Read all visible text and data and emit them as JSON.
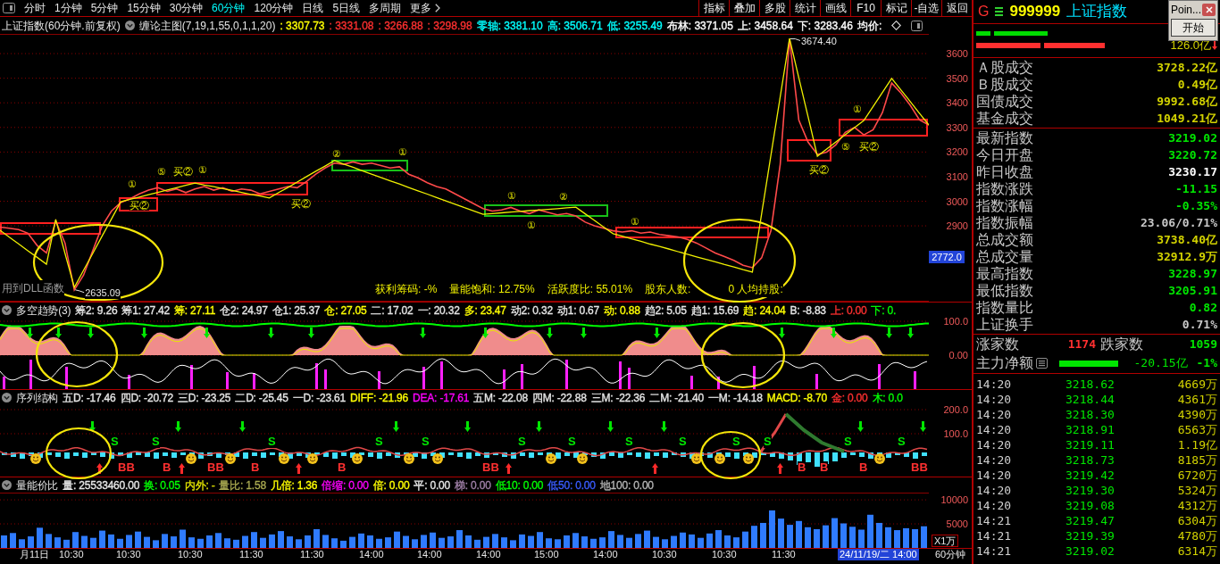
{
  "toolbar": {
    "periods": [
      {
        "label": "分时",
        "selected": false
      },
      {
        "label": "1分钟",
        "selected": false
      },
      {
        "label": "5分钟",
        "selected": false
      },
      {
        "label": "15分钟",
        "selected": false
      },
      {
        "label": "30分钟",
        "selected": false
      },
      {
        "label": "60分钟",
        "selected": true
      },
      {
        "label": "120分钟",
        "selected": false
      },
      {
        "label": "日线",
        "selected": false
      },
      {
        "label": "5日线",
        "selected": false
      },
      {
        "label": "多周期",
        "selected": false
      },
      {
        "label": "更多",
        "selected": false
      }
    ],
    "buttons": [
      "指标",
      "叠加",
      "多股",
      "统计",
      "画线",
      "F10",
      "标记",
      "-自选",
      "返回"
    ]
  },
  "main_chart": {
    "title": "上证指数(60分钟.前复权)",
    "indicator": "缠论主图(7,19,1,55,0,1,1,20)",
    "readouts": [
      {
        "text": ": 3307.73",
        "color": "#ffff00"
      },
      {
        "text": ": 3331.08",
        "color": "#ff3030"
      },
      {
        "text": ": 3266.88",
        "color": "#ff3030"
      },
      {
        "text": ": 3298.98",
        "color": "#ff3030"
      },
      {
        "text": "零轴: 3381.10",
        "color": "#00ffff"
      },
      {
        "text": "高: 3506.71",
        "color": "#00ffff"
      },
      {
        "text": "低: 3255.49",
        "color": "#00ffff"
      },
      {
        "text": "布林: 3371.05",
        "color": "#ffffff"
      },
      {
        "text": "上: 3458.64",
        "color": "#ffffff"
      },
      {
        "text": "下: 3283.46",
        "color": "#ffffff"
      },
      {
        "text": "均价:",
        "color": "#ffffff"
      }
    ],
    "high_label": "3674.40",
    "low_label": "2635.09",
    "note": "用到DLL函数",
    "price_tag": "2772.0",
    "stats": [
      "获利筹码: -%",
      "量能饱和: 12.75%",
      "活跃度比: 55.01%",
      "股东人数:",
      "0 人均持股:"
    ],
    "signals": [
      "①",
      "买②",
      "⑤",
      "买②",
      "①",
      "买②",
      "②",
      "①",
      "①",
      "①",
      "②",
      "①",
      "买②",
      "①",
      "⑤",
      "买②"
    ],
    "chart_data": {
      "type": "line",
      "ylim": [
        2592,
        3680
      ],
      "yticks": [
        2900,
        3000,
        3100,
        3200,
        3300,
        3400,
        3500,
        3600
      ],
      "grid": true,
      "series": [
        {
          "color": "#ff4a4a",
          "values": [
            2895,
            2890,
            2885,
            2870,
            2820,
            2790,
            2920,
            2830,
            2640,
            2700,
            2800,
            2900,
            2960,
            2995,
            3010,
            3030,
            3045,
            3055,
            3040,
            3050,
            3035,
            3050,
            3060,
            3045,
            3055,
            3040,
            3050,
            3045,
            3030,
            3040,
            3050,
            3060,
            3055,
            3080,
            3110,
            3135,
            3155,
            3150,
            3160,
            3150,
            3155,
            3145,
            3135,
            3140,
            3110,
            3095,
            3075,
            3060,
            3050,
            3030,
            3010,
            2990,
            2970,
            2960,
            2965,
            2975,
            2960,
            2950,
            2965,
            2955,
            2945,
            2950,
            2940,
            2915,
            2900,
            2890,
            2880,
            2875,
            2880,
            2870,
            2875,
            2865,
            2860,
            2855,
            2845,
            2830,
            2810,
            2790,
            2775,
            2760,
            2740,
            2730,
            2770,
            2880,
            3150,
            3660,
            3330,
            3240,
            3190,
            3200,
            3230,
            3280,
            3300,
            3270,
            3290,
            3360,
            3480,
            3440,
            3390,
            3330,
            3310
          ]
        },
        {
          "color": "#f0f000",
          "values": [
            2882,
            2854,
            2827,
            2799,
            2772,
            2744,
            2926,
            2788,
            2650,
            2720,
            2789,
            2859,
            2928,
            2998,
            3008,
            3017,
            3027,
            3036,
            3046,
            3055,
            3065,
            3074,
            3066,
            3059,
            3051,
            3044,
            3036,
            3028,
            3021,
            3013,
            3035,
            3056,
            3078,
            3100,
            3122,
            3143,
            3165,
            3151,
            3138,
            3124,
            3110,
            3097,
            3083,
            3070,
            3056,
            3042,
            3029,
            3015,
            3001,
            2988,
            2974,
            2961,
            2947,
            2950,
            2953,
            2956,
            2959,
            2962,
            2964,
            2967,
            2970,
            2973,
            2976,
            2949,
            2922,
            2895,
            2868,
            2858,
            2847,
            2837,
            2826,
            2816,
            2806,
            2795,
            2785,
            2774,
            2764,
            2754,
            2743,
            2733,
            2722,
            2712,
            2950,
            3187,
            3425,
            3662,
            3502,
            3343,
            3183,
            3212,
            3241,
            3270,
            3299,
            3328,
            3385,
            3442,
            3499,
            3452,
            3405,
            3357,
            3310
          ]
        }
      ]
    }
  },
  "trend_panel": {
    "title": "多空趋势(3)",
    "readouts": [
      {
        "text": "筹2: 9.26",
        "color": "#e6e6e6"
      },
      {
        "text": "筹1: 27.42",
        "color": "#e6e6e6"
      },
      {
        "text": "筹: 27.11",
        "color": "#ffff00"
      },
      {
        "text": "仓2: 24.97",
        "color": "#e6e6e6"
      },
      {
        "text": "仓1: 25.37",
        "color": "#e6e6e6"
      },
      {
        "text": "仓: 27.05",
        "color": "#ffff00"
      },
      {
        "text": "二: 17.02",
        "color": "#e6e6e6"
      },
      {
        "text": "一: 20.32",
        "color": "#e6e6e6"
      },
      {
        "text": "多: 23.47",
        "color": "#ffff00"
      },
      {
        "text": "动2: 0.32",
        "color": "#e6e6e6"
      },
      {
        "text": "动1: 0.67",
        "color": "#e6e6e6"
      },
      {
        "text": "动: 0.88",
        "color": "#ffff00"
      },
      {
        "text": "趋2: 5.05",
        "color": "#e6e6e6"
      },
      {
        "text": "趋1: 15.69",
        "color": "#e6e6e6"
      },
      {
        "text": "趋: 24.04",
        "color": "#ffff00"
      },
      {
        "text": "B: -8.83",
        "color": "#e6e6e6"
      },
      {
        "text": "上: 0.00",
        "color": "#ff3030"
      },
      {
        "text": "下: 0.",
        "color": "#00ff00"
      }
    ],
    "y_labels": [
      "100.0",
      "0.00"
    ]
  },
  "structure_panel": {
    "title": "序列结构",
    "readouts": [
      {
        "text": "五D: -17.46",
        "color": "#e6e6e6"
      },
      {
        "text": "四D: -20.72",
        "color": "#e6e6e6"
      },
      {
        "text": "三D: -23.25",
        "color": "#e6e6e6"
      },
      {
        "text": "二D: -25.45",
        "color": "#e6e6e6"
      },
      {
        "text": "一D: -23.61",
        "color": "#e6e6e6"
      },
      {
        "text": "DIFF: -21.96",
        "color": "#ffff00"
      },
      {
        "text": "DEA: -17.61",
        "color": "#ff00ff"
      },
      {
        "text": "五M: -22.08",
        "color": "#e6e6e6"
      },
      {
        "text": "四M: -22.88",
        "color": "#e6e6e6"
      },
      {
        "text": "三M: -22.36",
        "color": "#e6e6e6"
      },
      {
        "text": "二M: -21.40",
        "color": "#e6e6e6"
      },
      {
        "text": "一M: -14.18",
        "color": "#e6e6e6"
      },
      {
        "text": "MACD: -8.70",
        "color": "#ffff00"
      },
      {
        "text": "金: 0.00",
        "color": "#ff3030"
      },
      {
        "text": "木: 0.0",
        "color": "#00ff00"
      }
    ],
    "y_labels": [
      "200.0",
      "100.0"
    ],
    "signals": [
      {
        "text": "S",
        "kind": "sell"
      },
      {
        "text": "BB",
        "kind": "buy"
      },
      {
        "text": "S",
        "kind": "sell"
      },
      {
        "text": "B",
        "kind": "buy"
      },
      {
        "text": "BB",
        "kind": "buy"
      },
      {
        "text": "B",
        "kind": "buy"
      },
      {
        "text": "S",
        "kind": "sell"
      },
      {
        "text": "B",
        "kind": "buy"
      },
      {
        "text": "S",
        "kind": "sell"
      },
      {
        "text": "S",
        "kind": "sell"
      },
      {
        "text": "BB",
        "kind": "buy"
      },
      {
        "text": "S",
        "kind": "sell"
      },
      {
        "text": "S",
        "kind": "sell"
      },
      {
        "text": "S",
        "kind": "sell"
      },
      {
        "text": "S",
        "kind": "sell"
      },
      {
        "text": "S",
        "kind": "sell"
      },
      {
        "text": "S",
        "kind": "sell"
      },
      {
        "text": "B",
        "kind": "buy"
      },
      {
        "text": "B",
        "kind": "buy"
      },
      {
        "text": "S",
        "kind": "sell"
      },
      {
        "text": "B",
        "kind": "buy"
      },
      {
        "text": "S",
        "kind": "sell"
      },
      {
        "text": "BB",
        "kind": "buy"
      }
    ]
  },
  "volume_panel": {
    "title": "量能价比",
    "readouts": [
      {
        "text": "量: 25533460.00",
        "color": "#e6e6e6"
      },
      {
        "text": "换: 0.05",
        "color": "#00ff00"
      },
      {
        "text": "内外: -",
        "color": "#e0e000"
      },
      {
        "text": "量比: 1.58",
        "color": "#a8a850"
      },
      {
        "text": "几倍: 1.36",
        "color": "#ffff00"
      },
      {
        "text": "倍缩: 0.00",
        "color": "#ff00ff"
      },
      {
        "text": "倍: 0.00",
        "color": "#ffff00"
      },
      {
        "text": "平: 0.00",
        "color": "#e6e6e6"
      },
      {
        "text": "梯: 0.00",
        "color": "#a080a8"
      },
      {
        "text": "低10: 0.00",
        "color": "#00ff00"
      },
      {
        "text": "低50: 0.00",
        "color": "#3a5cff"
      },
      {
        "text": "地100: 0.00",
        "color": "#b4b4b4"
      }
    ],
    "unit": "X1万",
    "chart_data": {
      "type": "bar",
      "ylim": [
        0,
        11500
      ],
      "yticks": [
        5000,
        10000
      ],
      "grid": true,
      "series": [
        {
          "color": "#2f7bff",
          "values": [
            2600,
            3100,
            1800,
            2400,
            4200,
            2900,
            2200,
            1700,
            3300,
            2500,
            2100,
            3600,
            2800,
            1900,
            2700,
            3400,
            2300,
            1600,
            2900,
            2400,
            3800,
            2200,
            1900,
            2600,
            3100,
            2000,
            1700,
            2500,
            3300,
            2100,
            2800,
            3500,
            2400,
            1800,
            2600,
            3900,
            2700,
            2000,
            1500,
            2300,
            3000,
            2600,
            1900,
            2200,
            3400,
            2500,
            1800,
            2700,
            3200,
            2100,
            2400,
            3700,
            2600,
            1700,
            2300,
            2900,
            2200,
            1600,
            2800,
            2500,
            3300,
            2000,
            1800,
            2600,
            3100,
            2400,
            1900,
            2200,
            3500,
            2700,
            2100,
            2900,
            3600,
            2300,
            1800,
            2500,
            3200,
            2800,
            2100,
            3000,
            3700,
            2600,
            2200,
            3400,
            4600,
            5200,
            7800,
            6100,
            4800,
            5600,
            4300,
            3900,
            4700,
            6200,
            5100,
            4400,
            3800,
            6900,
            5200,
            4300,
            3700,
            4100,
            3900,
            4500
          ]
        }
      ]
    }
  },
  "time_axis": {
    "labels": [
      "月11日",
      "10:30",
      "10:30",
      "10:30",
      "11:30",
      "11:30",
      "14:00",
      "14:00",
      "14:00",
      "15:00",
      "14:00",
      "10:30",
      "10:30",
      "11:30"
    ],
    "cursor_time": "24/11/19/二 14:00",
    "period": "60分钟"
  },
  "quote_panel": {
    "market": "G",
    "code": "999999",
    "name": "上证指数",
    "turnover": "126.0亿",
    "volume_rows": [
      {
        "label": "Ａ股成交",
        "value": "3728.22亿",
        "color": "#d2d200"
      },
      {
        "label": "Ｂ股成交",
        "value": "0.49亿",
        "color": "#d2d200"
      },
      {
        "label": "国债成交",
        "value": "9992.68亿",
        "color": "#d2d200"
      },
      {
        "label": "基金成交",
        "value": "1049.21亿",
        "color": "#d2d200"
      }
    ],
    "stat_rows": [
      {
        "label": "最新指数",
        "value": "3219.02",
        "color": "#00e600"
      },
      {
        "label": "今日开盘",
        "value": "3220.72",
        "color": "#00e600"
      },
      {
        "label": "昨日收盘",
        "value": "3230.17",
        "color": "#ffffff"
      },
      {
        "label": "指数涨跌",
        "value": "-11.15",
        "color": "#00e600"
      },
      {
        "label": "指数涨幅",
        "value": "-0.35%",
        "color": "#00e600"
      },
      {
        "label": "指数振幅",
        "value": "23.06/0.71%",
        "color": "#c8c8c8"
      },
      {
        "label": "总成交额",
        "value": "3738.40亿",
        "color": "#d2d200"
      },
      {
        "label": "总成交量",
        "value": "32912.9万",
        "color": "#d2d200"
      },
      {
        "label": "最高指数",
        "value": "3228.97",
        "color": "#00e600"
      },
      {
        "label": "最低指数",
        "value": "3205.91",
        "color": "#00e600"
      },
      {
        "label": "指数量比",
        "value": "0.82",
        "color": "#00e600"
      },
      {
        "label": "上证换手",
        "value": "0.71%",
        "color": "#c8c8c8"
      }
    ],
    "breadth": {
      "up_label": "涨家数",
      "up_count": "1174",
      "down_label": "跌家数",
      "down_count": "1059"
    },
    "main_flow": {
      "label": "主力净额",
      "value": "-20.15亿",
      "percent": "-1%"
    },
    "ticks": [
      {
        "time": "14:20",
        "price": "3218.62",
        "volume": "4669万"
      },
      {
        "time": "14:20",
        "price": "3218.44",
        "volume": "4361万"
      },
      {
        "time": "14:20",
        "price": "3218.30",
        "volume": "4390万"
      },
      {
        "time": "14:20",
        "price": "3218.91",
        "volume": "6563万"
      },
      {
        "time": "14:20",
        "price": "3219.11",
        "volume": "1.19亿"
      },
      {
        "time": "14:20",
        "price": "3218.73",
        "volume": "8185万"
      },
      {
        "time": "14:20",
        "price": "3219.42",
        "volume": "6720万"
      },
      {
        "time": "14:20",
        "price": "3219.30",
        "volume": "5324万"
      },
      {
        "time": "14:20",
        "price": "3219.08",
        "volume": "4312万"
      },
      {
        "time": "14:21",
        "price": "3219.47",
        "volume": "6304万"
      },
      {
        "time": "14:21",
        "price": "3219.39",
        "volume": "4780万"
      },
      {
        "time": "14:21",
        "price": "3219.02",
        "volume": "6314万"
      }
    ]
  },
  "popup": {
    "title": "Poin...",
    "button": "开始"
  }
}
